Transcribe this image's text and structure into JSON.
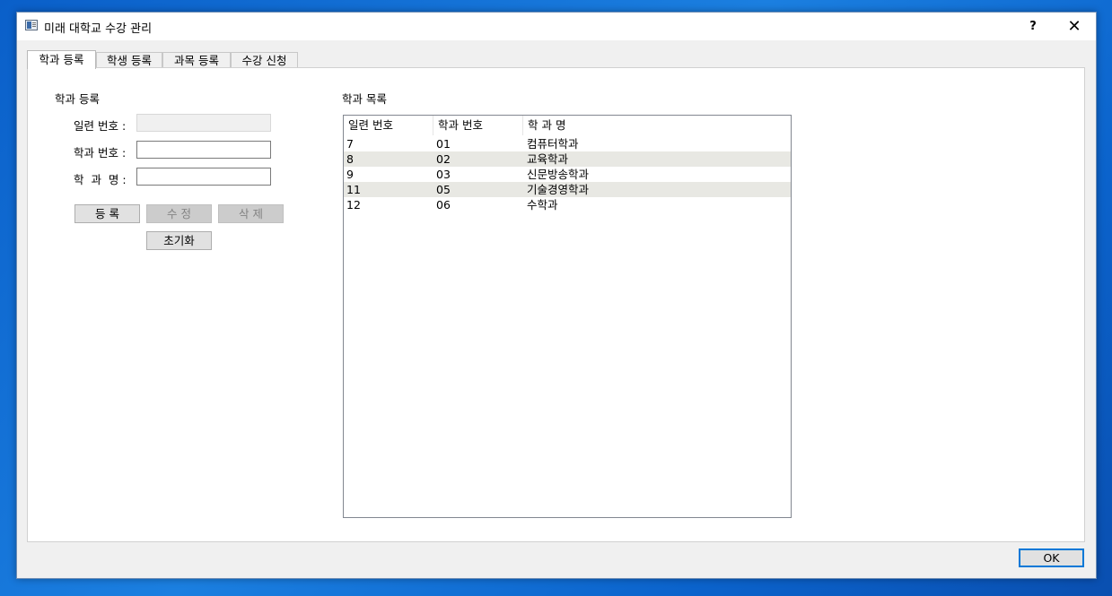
{
  "window": {
    "title": "미래 대학교 수강 관리",
    "help_label": "?",
    "close_label": "✕"
  },
  "tabs": [
    {
      "label": "학과 등록",
      "active": true
    },
    {
      "label": "학생 등록",
      "active": false
    },
    {
      "label": "과목 등록",
      "active": false
    },
    {
      "label": "수강 신청",
      "active": false
    }
  ],
  "form": {
    "group_label": "학과 등록",
    "serial_label": "일련 번호 :",
    "serial_value": "",
    "dept_code_label": "학과 번호 :",
    "dept_code_value": "",
    "dept_name_label": "학  과  명 :",
    "dept_name_value": "",
    "register_label": "등 록",
    "modify_label": "수 정",
    "delete_label": "삭 제",
    "reset_label": "초기화"
  },
  "list": {
    "group_label": "학과 목록",
    "columns": [
      "일련 번호",
      "학과 번호",
      "학 과 명"
    ],
    "rows": [
      [
        "7",
        "01",
        "컴퓨터학과"
      ],
      [
        "8",
        "02",
        "교육학과"
      ],
      [
        "9",
        "03",
        "신문방송학과"
      ],
      [
        "11",
        "05",
        "기술경영학과"
      ],
      [
        "12",
        "06",
        "수학과"
      ]
    ]
  },
  "footer": {
    "ok_label": "OK"
  },
  "colors": {
    "desktop": "#1b7fe0",
    "alt_row": "#e8e8e3",
    "focus_border": "#0078d7"
  }
}
